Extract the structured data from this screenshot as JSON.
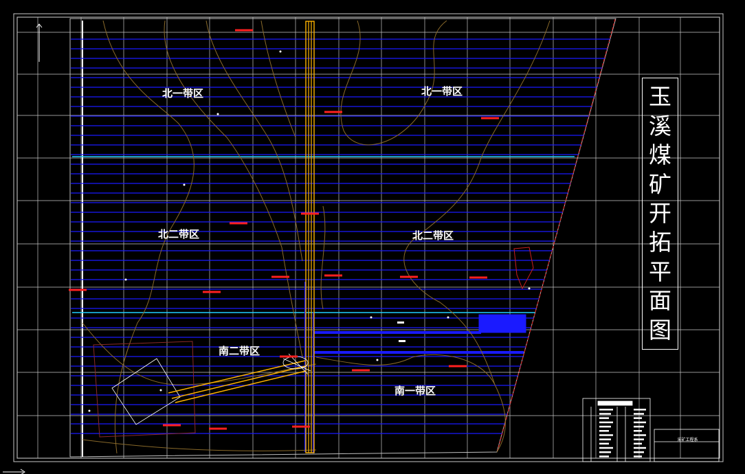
{
  "drawing": {
    "title_chars": [
      "玉",
      "溪",
      "煤",
      "矿",
      "开",
      "拓",
      "平",
      "面",
      "图"
    ],
    "sheet_label": "采矿工程系",
    "zones": {
      "north1_left": "北一带区",
      "north1_right": "北一带区",
      "north2_left": "北二带区",
      "north2_right": "北二带区",
      "south2": "南二带区",
      "south1": "南一带区"
    }
  },
  "colors": {
    "background": "#000000",
    "grid": "#c8c8c8",
    "seam_lines": "#1a1aff",
    "shaft": "#ffb300",
    "contour": "#8a6a2a",
    "boundary": "#c0c0c0",
    "cyan_lines": "#20d0ff",
    "point_labels": "#ff2020",
    "text": "#ffffff"
  }
}
